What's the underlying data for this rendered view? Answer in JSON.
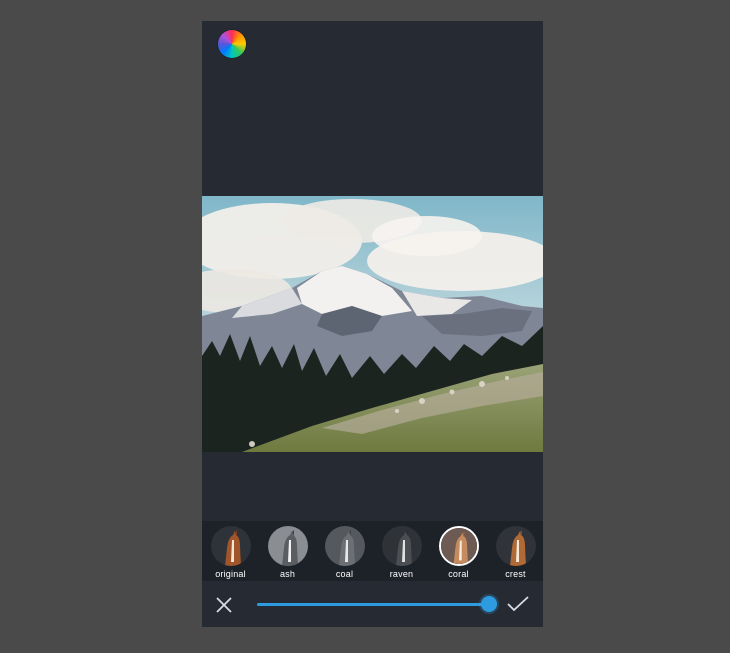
{
  "app": {
    "logo_icon": "color-wheel-icon"
  },
  "filters": {
    "items": [
      {
        "label": "original",
        "tone": "original",
        "selected": false
      },
      {
        "label": "ash",
        "tone": "mono",
        "selected": false
      },
      {
        "label": "coal",
        "tone": "mono-dark",
        "selected": false
      },
      {
        "label": "raven",
        "tone": "mono-darker",
        "selected": false
      },
      {
        "label": "coral",
        "tone": "warm",
        "selected": true
      },
      {
        "label": "crest",
        "tone": "original",
        "selected": false
      }
    ]
  },
  "intensity": {
    "value": 1.0
  },
  "actions": {
    "cancel_icon": "close-icon",
    "confirm_icon": "checkmark-icon"
  },
  "colors": {
    "accent": "#2e9be0",
    "panel": "#262b33",
    "strip": "#1d2128",
    "backdrop": "#4a4a4a"
  }
}
